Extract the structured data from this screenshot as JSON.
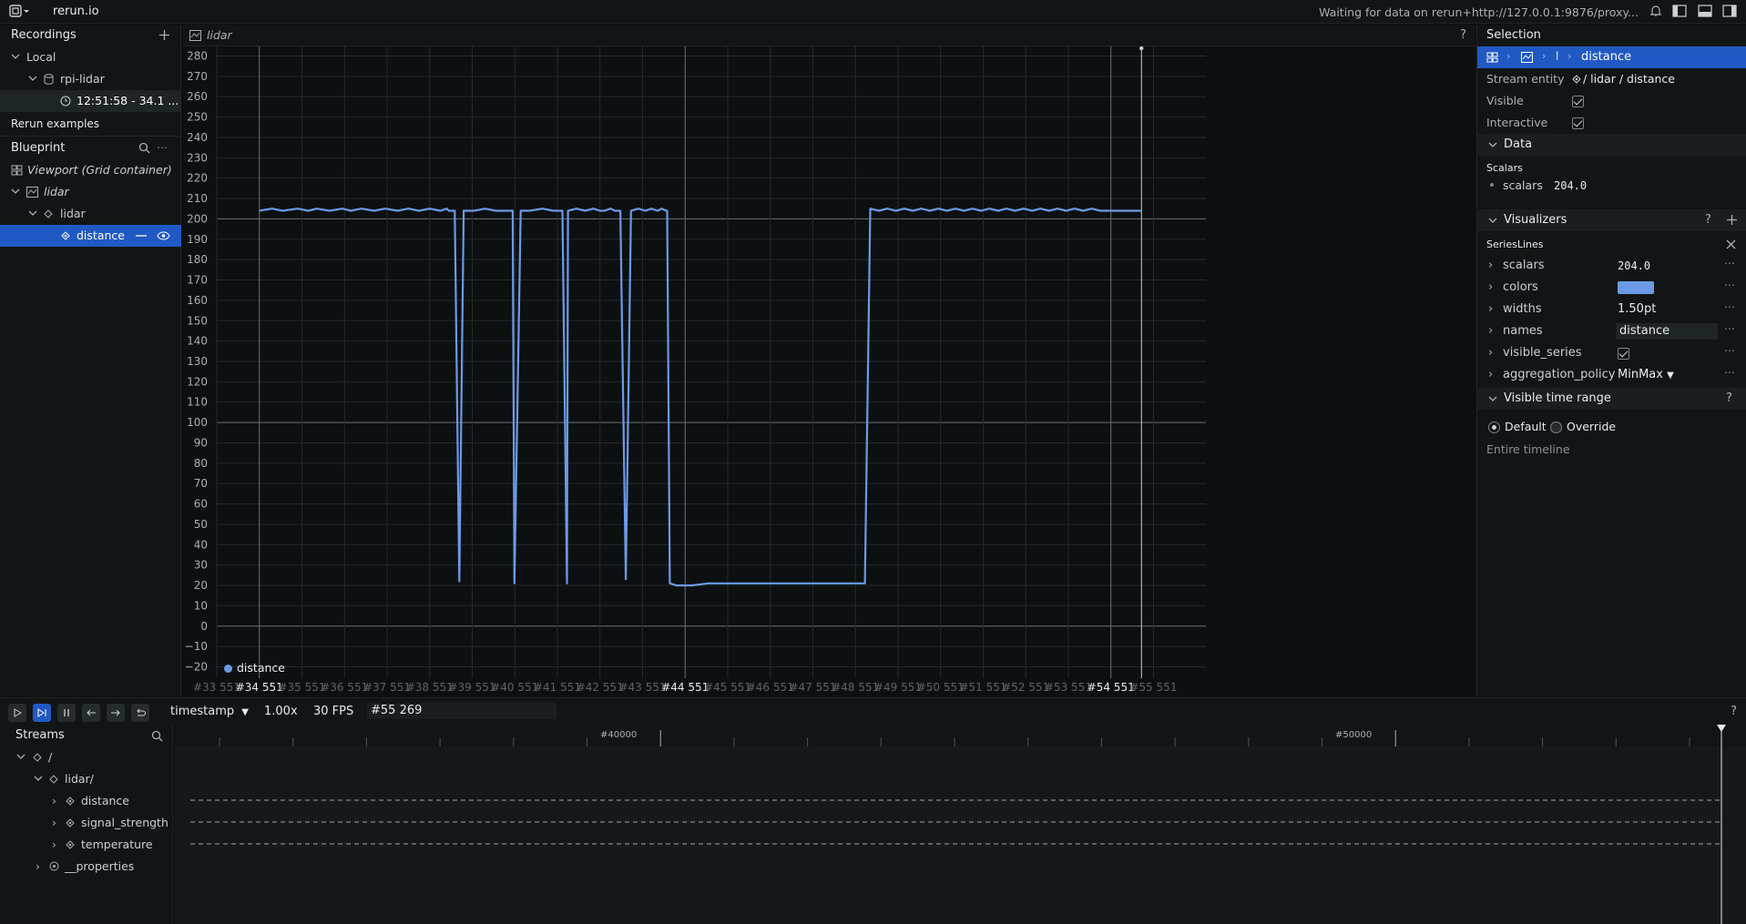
{
  "app": {
    "title": "rerun.io",
    "status": "Waiting for data on rerun+http://127.0.0.1:9876/proxy..."
  },
  "colors": {
    "accent": "#2159c4",
    "series": "#6b9ae6",
    "bg": "#0d1011",
    "panel": "#121516"
  },
  "left": {
    "recordings_label": "Recordings",
    "local_label": "Local",
    "app_name": "rpi-lidar",
    "recording_time": "12:51:58 - 34.1 ...",
    "examples_label": "Rerun examples",
    "blueprint_label": "Blueprint",
    "viewport_label": "Viewport (Grid container)",
    "view_label": "lidar",
    "entity_group": "lidar",
    "entity_selected": "distance"
  },
  "plot": {
    "tab_title": "lidar",
    "help": "?",
    "legend_label": "distance",
    "y_ticks": [
      "280",
      "270",
      "260",
      "250",
      "240",
      "230",
      "220",
      "210",
      "200",
      "190",
      "180",
      "170",
      "160",
      "150",
      "140",
      "130",
      "120",
      "110",
      "100",
      "90",
      "80",
      "70",
      "60",
      "50",
      "40",
      "30",
      "20",
      "10",
      "0",
      "−10",
      "−20"
    ],
    "x_ticks": [
      "#33 551",
      "#34 551",
      "#35 551",
      "#36 551",
      "#37 551",
      "#38 551",
      "#39 551",
      "#40 551",
      "#41 551",
      "#42 551",
      "#43 551",
      "#44 551",
      "#45 551",
      "#46 551",
      "#47 551",
      "#48 551",
      "#49 551",
      "#50 551",
      "#51 551",
      "#52 551",
      "#53 551",
      "#54 551",
      "#55 551"
    ],
    "x_major_ticks": [
      "#34 551",
      "#44 551",
      "#54 551"
    ]
  },
  "chart_data": {
    "type": "line",
    "xlabel": "",
    "ylabel": "",
    "ylim": [
      -22,
      282
    ],
    "xlim": [
      33551,
      56782
    ],
    "legend": "bottom-left",
    "series": [
      {
        "name": "distance",
        "x": [
          34551,
          34850,
          35100,
          35450,
          35700,
          35900,
          36200,
          36500,
          36700,
          36950,
          37250,
          37500,
          37800,
          38050,
          38300,
          38550,
          38800,
          38950,
          39000,
          39140,
          39247,
          39350,
          39600,
          39850,
          40100,
          40300,
          40400,
          40500,
          40542,
          40690,
          40900,
          41200,
          41450,
          41550,
          41600,
          41670,
          41777,
          41800,
          42000,
          42200,
          42400,
          42550,
          42650,
          42800,
          42900,
          43030,
          43157,
          43280,
          43450,
          43620,
          43760,
          43900,
          44000,
          44110,
          44130,
          44190,
          44350,
          44700,
          45100,
          45500,
          45900,
          46400,
          46800,
          47300,
          47800,
          48300,
          48650,
          48773,
          48900,
          49100,
          49300,
          49500,
          49700,
          49900,
          50100,
          50300,
          50500,
          50700,
          50900,
          51100,
          51300,
          51500,
          51700,
          51900,
          52100,
          52300,
          52500,
          52700,
          52900,
          53100,
          53300,
          53500,
          53700,
          53900,
          54100,
          54300,
          54551,
          55000,
          55269
        ],
        "y": [
          204,
          205,
          204,
          205,
          204,
          205,
          204,
          205,
          204,
          205,
          204,
          205,
          204,
          205,
          204,
          205,
          204,
          205,
          204,
          204,
          22,
          204,
          204,
          205,
          204,
          204,
          204,
          204,
          21,
          204,
          204,
          205,
          204,
          204,
          204,
          204,
          21,
          204,
          205,
          204,
          205,
          204,
          204,
          205,
          204,
          204,
          23,
          204,
          205,
          204,
          205,
          204,
          205,
          204,
          204,
          21,
          20,
          20,
          21,
          21,
          21,
          21,
          21,
          21,
          21,
          21,
          21,
          21,
          205,
          204,
          205,
          204,
          205,
          204,
          205,
          204,
          205,
          204,
          205,
          204,
          205,
          204,
          205,
          204,
          205,
          204,
          205,
          204,
          205,
          204,
          205,
          204,
          205,
          204,
          205,
          204,
          204,
          204,
          204
        ],
        "color": "#6b9ae6"
      }
    ]
  },
  "right": {
    "selection_label": "Selection",
    "breadcrumb_sep": "l",
    "breadcrumb_current": "distance",
    "stream_entity_label": "Stream entity",
    "stream_entity_value": "/ lidar / distance",
    "visible_label": "Visible",
    "interactive_label": "Interactive",
    "data_label": "Data",
    "scalars_header": "Scalars",
    "scalars_label": "scalars",
    "scalars_value": "204.0",
    "visualizers_label": "Visualizers",
    "serieslines_label": "SeriesLines",
    "props": [
      {
        "label": "scalars",
        "value": "204.0"
      },
      {
        "label": "colors",
        "value": ""
      },
      {
        "label": "widths",
        "value": "1.50pt"
      },
      {
        "label": "names",
        "value": "distance"
      },
      {
        "label": "visible_series",
        "value": ""
      },
      {
        "label": "aggregation_policy",
        "value": "MinMax"
      }
    ],
    "time_range_label": "Visible time range",
    "default_label": "Default",
    "override_label": "Override",
    "entire_timeline": "Entire timeline"
  },
  "time": {
    "timeline_name": "timestamp",
    "speed": "1.00x",
    "fps": "30 FPS",
    "current": "#55 269",
    "help": "?",
    "ruler_labels": [
      "#40000",
      "#50000"
    ]
  },
  "streams": {
    "title": "Streams",
    "root": "/",
    "lidar": "lidar/",
    "children": [
      "distance",
      "signal_strength",
      "temperature"
    ],
    "properties": "__properties"
  }
}
